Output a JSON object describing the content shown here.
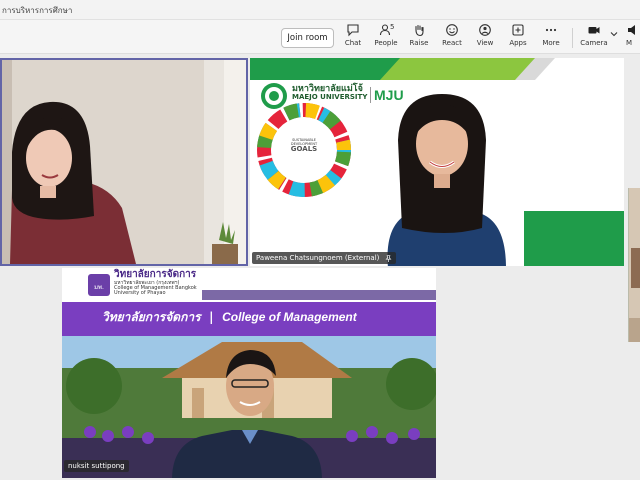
{
  "window": {
    "title": "การบริหารการศึกษา"
  },
  "toolbar": {
    "join_label": "Join room",
    "chat": "Chat",
    "people": "People",
    "people_count": "5",
    "raise": "Raise",
    "react": "React",
    "view": "View",
    "apps": "Apps",
    "more": "More",
    "camera": "Camera",
    "mic_partial": "M"
  },
  "participants": {
    "p2_name": "Paweena Chatsungnoem (External)",
    "p3_name": "nuksit suttipong"
  },
  "maejo": {
    "thai": "มหาวิทยาลัยแม่โจ้",
    "english": "MAEJO UNIVERSITY",
    "mark": "MJU",
    "sdg": [
      "SUSTAINABLE",
      "DEVELOPMENT",
      "GOALS"
    ]
  },
  "college": {
    "thai_name": "วิทยาลัยการจัดการ",
    "thai_sub": "มหาวิทยาลัยพะเยา (กรุงเทพฯ)",
    "en_line1": "College of Management Bangkok",
    "en_line2": "University of Phayao",
    "seal": "มพ.",
    "banner_thai": "วิทยาลัยการจัดการ",
    "banner_sep": "|",
    "banner_en": "College of Management"
  },
  "colors": {
    "accent": "#6264a7",
    "maejo_green": "#1f9c4a",
    "college_purple": "#7a3ec0"
  }
}
